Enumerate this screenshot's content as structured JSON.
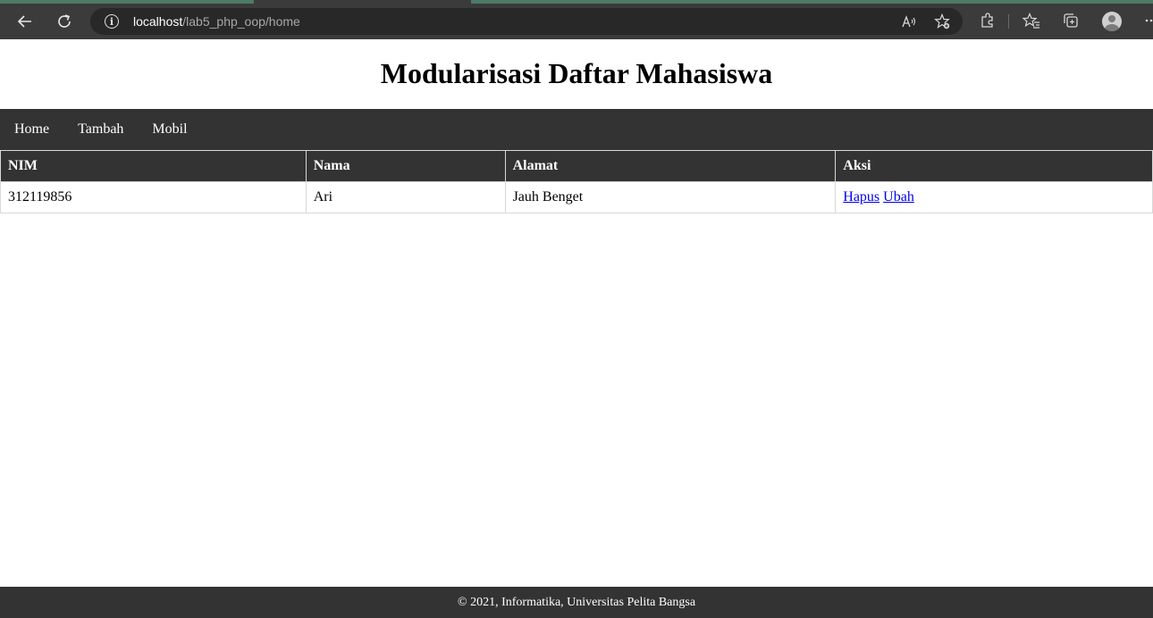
{
  "browser": {
    "url_host": "localhost",
    "url_path": "/lab5_php_oop/home",
    "read_aloud_label": "A⁾"
  },
  "page": {
    "title": "Modularisasi Daftar Mahasiswa"
  },
  "nav": {
    "items": [
      {
        "label": "Home"
      },
      {
        "label": "Tambah"
      },
      {
        "label": "Mobil"
      }
    ]
  },
  "table": {
    "headers": [
      "NIM",
      "Nama",
      "Alamat",
      "Aksi"
    ],
    "rows": [
      {
        "nim": "312119856",
        "nama": "Ari",
        "alamat": "Jauh Benget",
        "actions": [
          "Hapus",
          "Ubah"
        ]
      }
    ]
  },
  "footer": {
    "text": "© 2021, Informatika, Universitas Pelita Bangsa"
  }
}
